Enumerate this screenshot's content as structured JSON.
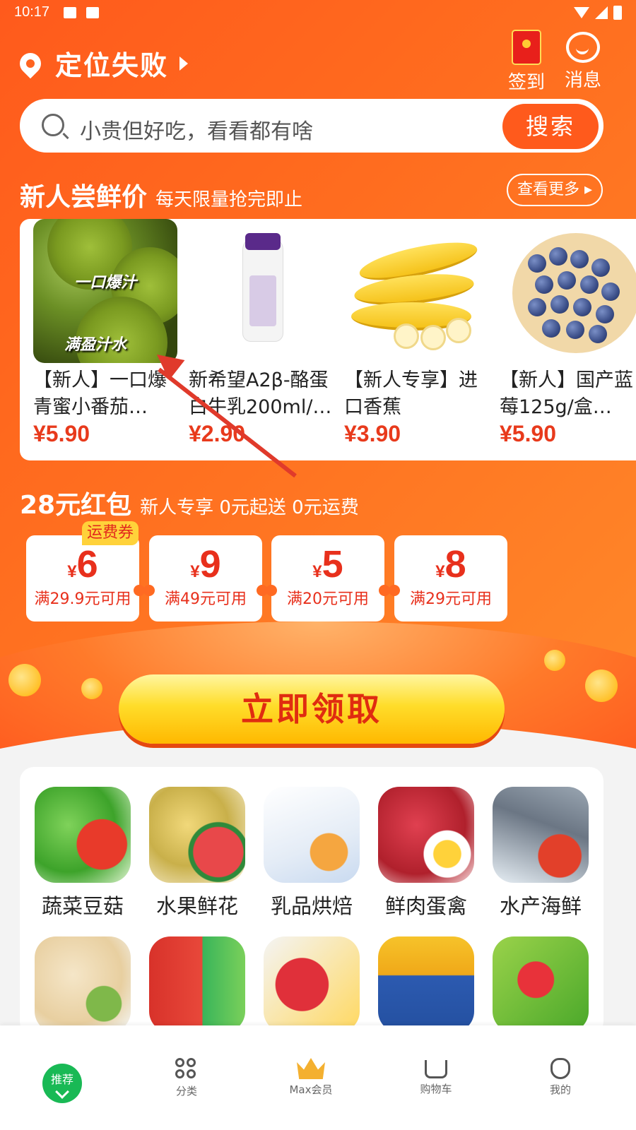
{
  "status_bar": {
    "time": "10:17"
  },
  "header": {
    "location_text": "定位失败",
    "checkin_label": "签到",
    "messages_label": "消息"
  },
  "search": {
    "placeholder": "小贵但好吃，看看都有啥",
    "button_label": "搜索"
  },
  "new_user_section": {
    "title": "新人尝鲜价",
    "subtitle": "每天限量抢完即止",
    "more_label": "查看更多"
  },
  "products": [
    {
      "name": "【新人】一口爆青蜜小番茄…",
      "price": "¥5.90",
      "image_text_1": "一口爆汁",
      "image_text_2": "满盈汁水"
    },
    {
      "name": "新希望A2β-酪蛋白牛乳200ml/…",
      "price": "¥2.90"
    },
    {
      "name": "【新人专享】进口香蕉",
      "price": "¥3.90"
    },
    {
      "name": "【新人】国产蓝莓125g/盒…",
      "price": "¥5.90"
    }
  ],
  "coupon_section": {
    "title": "28元红包",
    "subtitle": "新人专享 0元起送 0元运费",
    "tag": "运费券",
    "claim_label": "立即领取",
    "coupons": [
      {
        "currency": "¥",
        "amount": "6",
        "condition": "满29.9元可用"
      },
      {
        "currency": "¥",
        "amount": "9",
        "condition": "满49元可用"
      },
      {
        "currency": "¥",
        "amount": "5",
        "condition": "满20元可用"
      },
      {
        "currency": "¥",
        "amount": "8",
        "condition": "满29元可用"
      }
    ]
  },
  "categories": [
    {
      "label": "蔬菜豆菇"
    },
    {
      "label": "水果鲜花"
    },
    {
      "label": "乳品烘焙"
    },
    {
      "label": "鲜肉蛋禽"
    },
    {
      "label": "水产海鲜"
    }
  ],
  "bottom_nav": {
    "home_label": "推荐",
    "items": [
      {
        "label": "分类"
      },
      {
        "label": "Max会员"
      },
      {
        "label": "购物车"
      },
      {
        "label": "我的"
      }
    ]
  },
  "colors": {
    "brand_orange": "#ff5a1c",
    "price_red": "#e83a1c",
    "nav_green": "#19b955",
    "claim_yellow": "#ffdd2a"
  },
  "icons": [
    "location-pin-icon",
    "red-envelope-icon",
    "message-icon",
    "search-icon",
    "grid-icon",
    "crown-icon",
    "cart-icon",
    "profile-icon"
  ]
}
